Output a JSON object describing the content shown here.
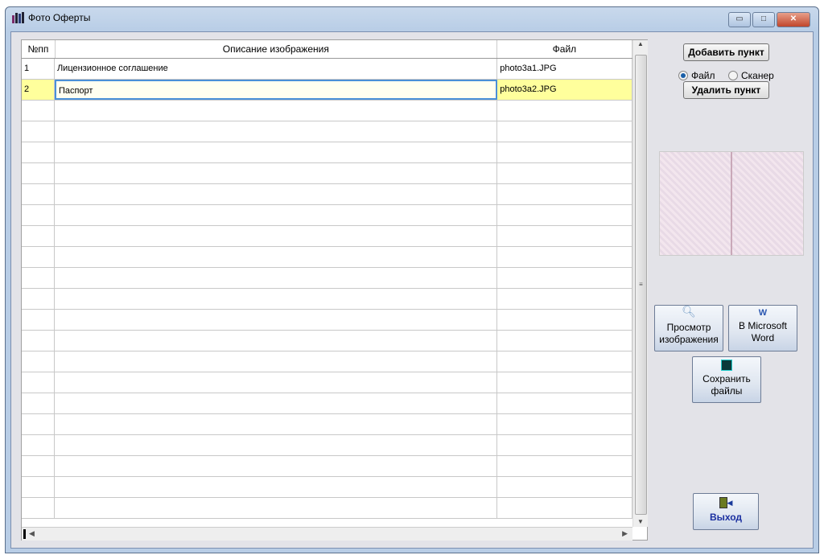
{
  "window": {
    "title": "Фото Оферты",
    "minimize": "▭",
    "maximize": "□",
    "close": "✕"
  },
  "table": {
    "columns": [
      "№пп",
      "Описание изображения",
      "Файл"
    ],
    "rows": [
      {
        "num": "1",
        "description": "Лицензионное соглашение",
        "file": "photo3a1.JPG"
      },
      {
        "num": "2",
        "description": "Паспорт",
        "file": "photo3a2.JPG"
      }
    ],
    "selected_row": 2,
    "empty_rows": 20
  },
  "side": {
    "add_item": "Добавить пункт",
    "radio_file": "Файл",
    "radio_scanner": "Сканер",
    "radio_selected": "file",
    "delete_item": "Удалить пункт",
    "view_image": [
      "Просмотр",
      "изображения"
    ],
    "to_word": [
      "В Microsoft",
      "Word"
    ],
    "save_files": [
      "Сохранить",
      "файлы"
    ],
    "exit": "Выход"
  }
}
